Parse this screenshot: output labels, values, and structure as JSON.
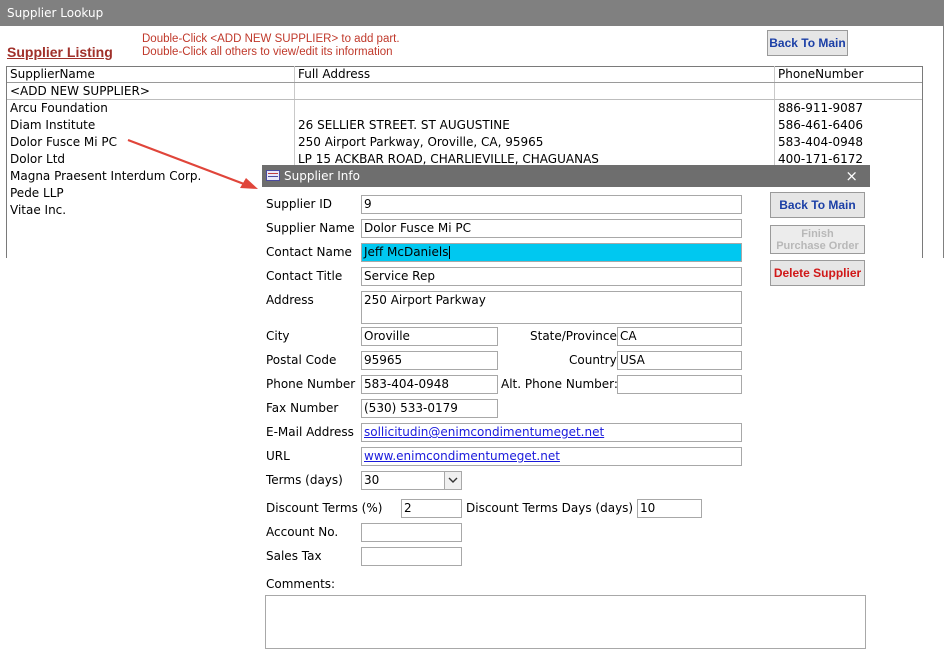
{
  "lookup": {
    "window_title": "Supplier Lookup",
    "listing_title": "Supplier Listing",
    "hint_line1": "Double-Click <ADD NEW SUPPLIER> to add part.",
    "hint_line2": "Double-Click all others to view/edit its information",
    "back_button": "Back To Main",
    "columns": [
      "SupplierName",
      "Full Address",
      "PhoneNumber"
    ],
    "rows": [
      {
        "name": "<ADD NEW SUPPLIER>",
        "address": "",
        "phone": ""
      },
      {
        "name": "Arcu Foundation",
        "address": "",
        "phone": "886-911-9087"
      },
      {
        "name": "Diam Institute",
        "address": "26 SELLIER STREET. ST AUGUSTINE",
        "phone": "586-461-6406"
      },
      {
        "name": "Dolor Fusce Mi PC",
        "address": "250 Airport Parkway, Oroville, CA, 95965",
        "phone": "583-404-0948"
      },
      {
        "name": "Dolor Ltd",
        "address": "LP 15 ACKBAR ROAD, CHARLIEVILLE, CHAGUANAS",
        "phone": "400-171-6172"
      },
      {
        "name": "Magna Praesent Interdum Corp.",
        "address": "",
        "phone": ""
      },
      {
        "name": "Pede LLP",
        "address": "",
        "phone": ""
      },
      {
        "name": "Vitae Inc.",
        "address": "",
        "phone": ""
      }
    ]
  },
  "info": {
    "window_title": "Supplier Info",
    "close_glyph": "×",
    "buttons": {
      "back": "Back To Main",
      "finish_line1": "Finish",
      "finish_line2": "Purchase Order",
      "delete": "Delete Supplier"
    },
    "labels": {
      "supplier_id": "Supplier ID",
      "supplier_name": "Supplier Name",
      "contact_name": "Contact Name",
      "contact_title": "Contact Title",
      "address": "Address",
      "city": "City",
      "state": "State/Province",
      "postal": "Postal Code",
      "country": "Country",
      "phone": "Phone Number",
      "alt_phone": "Alt. Phone Number:",
      "fax": "Fax Number",
      "email": "E-Mail Address",
      "url": "URL",
      "terms": "Terms  (days)",
      "discount_terms": "Discount Terms (%)",
      "discount_days": "Discount Terms Days (days)",
      "account": "Account No.",
      "sales_tax": "Sales Tax",
      "comments": "Comments:"
    },
    "values": {
      "supplier_id": "9",
      "supplier_name": "Dolor Fusce Mi PC",
      "contact_name": "Jeff McDaniels",
      "contact_title": "Service Rep",
      "address": "250 Airport Parkway",
      "city": "Oroville",
      "state": "CA",
      "postal": "95965",
      "country": "USA",
      "phone": "583-404-0948",
      "alt_phone": "",
      "fax": "(530) 533-0179",
      "email": "sollicitudin@enimcondimentumeget.net",
      "url": "www.enimcondimentumeget.net",
      "terms": "30",
      "discount_terms": "2",
      "discount_days": "10",
      "account": "",
      "sales_tax": "",
      "comments": ""
    }
  },
  "colors": {
    "highlight": "#00c8f0",
    "annotation_arrow": "#e0453a"
  }
}
